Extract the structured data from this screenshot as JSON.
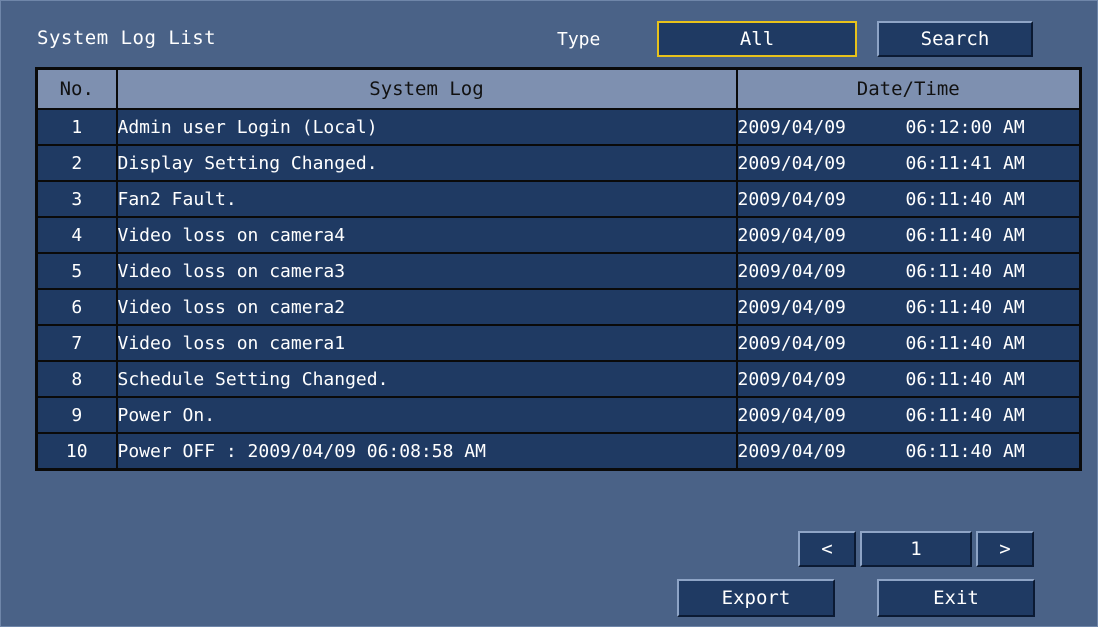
{
  "header": {
    "title": "System Log List",
    "type_label": "Type",
    "type_value": "All",
    "search_label": "Search"
  },
  "table": {
    "columns": [
      "No.",
      "System Log",
      "Date/Time"
    ],
    "rows": [
      {
        "no": "1",
        "log": "Admin user Login (Local)",
        "date": "2009/04/09",
        "time": "06:12:00 AM"
      },
      {
        "no": "2",
        "log": "Display Setting Changed.",
        "date": "2009/04/09",
        "time": "06:11:41 AM"
      },
      {
        "no": "3",
        "log": "Fan2 Fault.",
        "date": "2009/04/09",
        "time": "06:11:40 AM"
      },
      {
        "no": "4",
        "log": "Video loss on camera4",
        "date": "2009/04/09",
        "time": "06:11:40 AM"
      },
      {
        "no": "5",
        "log": "Video loss on camera3",
        "date": "2009/04/09",
        "time": "06:11:40 AM"
      },
      {
        "no": "6",
        "log": "Video loss on camera2",
        "date": "2009/04/09",
        "time": "06:11:40 AM"
      },
      {
        "no": "7",
        "log": "Video loss on camera1",
        "date": "2009/04/09",
        "time": "06:11:40 AM"
      },
      {
        "no": "8",
        "log": "Schedule Setting Changed.",
        "date": "2009/04/09",
        "time": "06:11:40 AM"
      },
      {
        "no": "9",
        "log": "Power On.",
        "date": "2009/04/09",
        "time": "06:11:40 AM"
      },
      {
        "no": "10",
        "log": "Power OFF : 2009/04/09 06:08:58 AM",
        "date": "2009/04/09",
        "time": "06:11:40 AM"
      }
    ]
  },
  "pager": {
    "prev_label": "<",
    "page": "1",
    "next_label": ">"
  },
  "footer": {
    "export_label": "Export",
    "exit_label": "Exit"
  },
  "colors": {
    "background": "#4a6287",
    "cell": "#1f3a63",
    "header_cell": "#7e90b0",
    "focus_border": "#e8c21b"
  }
}
